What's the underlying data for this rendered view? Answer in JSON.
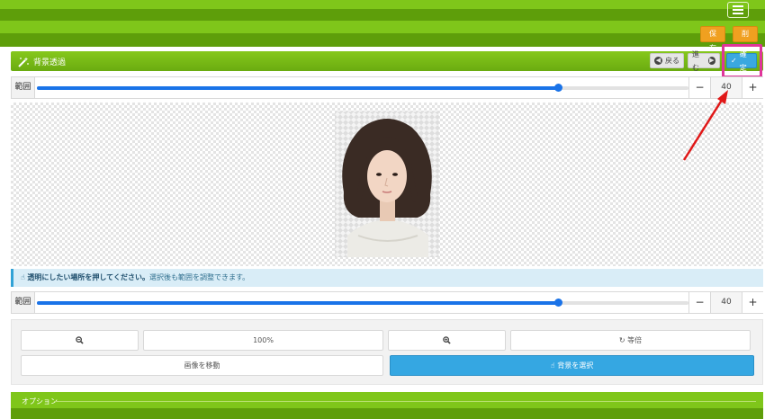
{
  "header": {
    "save_label": "保存",
    "delete_label": "削除"
  },
  "panel": {
    "title": "背景透過",
    "back_label": "戻る",
    "forward_label": "進む",
    "confirm_label": "確定"
  },
  "range_top": {
    "label": "範囲",
    "value": "40",
    "minus": "−",
    "plus": "+",
    "level_fraction": 0.8
  },
  "range_bottom": {
    "label": "範囲",
    "value": "40",
    "minus": "−",
    "plus": "+",
    "level_fraction": 0.8
  },
  "info": {
    "strong": "透明にしたい場所を押してください。",
    "text": "選択後も範囲を調整できます。"
  },
  "tools": {
    "zoom_level": "100%",
    "actual_size": "等倍",
    "move_image": "画像を移動",
    "select_background": "背景を選択"
  },
  "options": {
    "title": "オプション"
  },
  "colors": {
    "accent_green": "#7fc61a",
    "orange": "#f0a020",
    "primary_blue": "#35a7e2",
    "highlight": "#e0359a",
    "arrow": "#e01818"
  }
}
